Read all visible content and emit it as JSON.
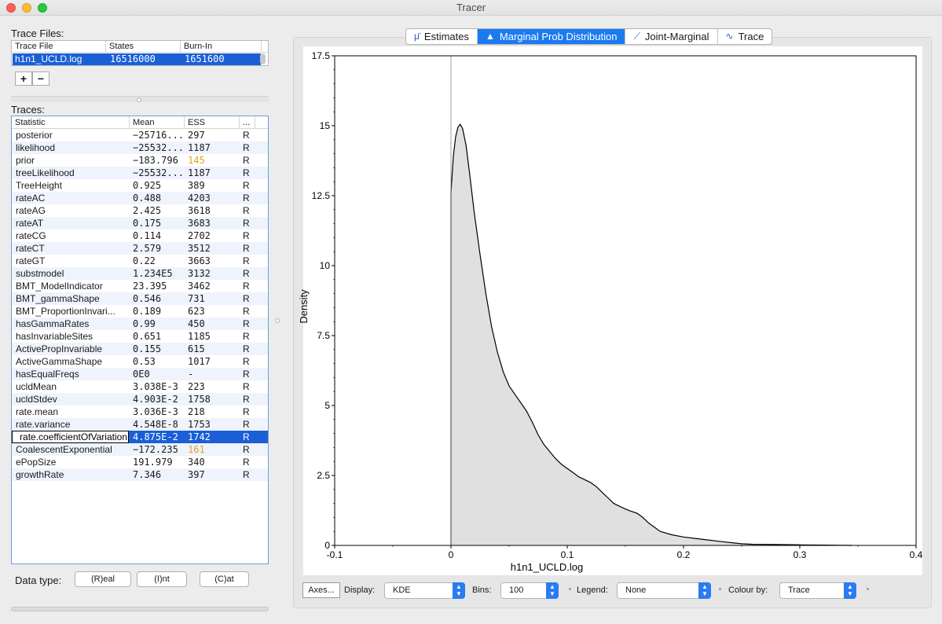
{
  "window": {
    "title": "Tracer"
  },
  "trace_files": {
    "label": "Trace Files:",
    "columns": [
      "Trace File",
      "States",
      "Burn-In"
    ],
    "row": {
      "file": "h1n1_UCLD.log",
      "states": "16516000",
      "burnin": "1651600"
    },
    "add_label": "+",
    "remove_label": "−"
  },
  "traces": {
    "label": "Traces:",
    "columns": [
      "Statistic",
      "Mean",
      "ESS",
      "..."
    ],
    "rows": [
      {
        "stat": "posterior",
        "mean": "−25716...",
        "ess": "297",
        "type": "R"
      },
      {
        "stat": "likelihood",
        "mean": "−25532...",
        "ess": "1187",
        "type": "R"
      },
      {
        "stat": "prior",
        "mean": "−183.796",
        "ess": "145",
        "type": "R"
      },
      {
        "stat": "treeLikelihood",
        "mean": "−25532...",
        "ess": "1187",
        "type": "R"
      },
      {
        "stat": "TreeHeight",
        "mean": "0.925",
        "ess": "389",
        "type": "R"
      },
      {
        "stat": "rateAC",
        "mean": "0.488",
        "ess": "4203",
        "type": "R"
      },
      {
        "stat": "rateAG",
        "mean": "2.425",
        "ess": "3618",
        "type": "R"
      },
      {
        "stat": "rateAT",
        "mean": "0.175",
        "ess": "3683",
        "type": "R"
      },
      {
        "stat": "rateCG",
        "mean": "0.114",
        "ess": "2702",
        "type": "R"
      },
      {
        "stat": "rateCT",
        "mean": "2.579",
        "ess": "3512",
        "type": "R"
      },
      {
        "stat": "rateGT",
        "mean": "0.22",
        "ess": "3663",
        "type": "R"
      },
      {
        "stat": "substmodel",
        "mean": "1.234E5",
        "ess": "3132",
        "type": "R"
      },
      {
        "stat": "BMT_ModelIndicator",
        "mean": "23.395",
        "ess": "3462",
        "type": "R"
      },
      {
        "stat": "BMT_gammaShape",
        "mean": "0.546",
        "ess": "731",
        "type": "R"
      },
      {
        "stat": "BMT_ProportionInvari...",
        "mean": "0.189",
        "ess": "623",
        "type": "R"
      },
      {
        "stat": "hasGammaRates",
        "mean": "0.99",
        "ess": "450",
        "type": "R"
      },
      {
        "stat": "hasInvariableSites",
        "mean": "0.651",
        "ess": "1185",
        "type": "R"
      },
      {
        "stat": "ActivePropInvariable",
        "mean": "0.155",
        "ess": "615",
        "type": "R"
      },
      {
        "stat": "ActiveGammaShape",
        "mean": "0.53",
        "ess": "1017",
        "type": "R"
      },
      {
        "stat": "hasEqualFreqs",
        "mean": "0E0",
        "ess": "-",
        "type": "R"
      },
      {
        "stat": "ucldMean",
        "mean": "3.038E-3",
        "ess": "223",
        "type": "R"
      },
      {
        "stat": "ucldStdev",
        "mean": "4.903E-2",
        "ess": "1758",
        "type": "R"
      },
      {
        "stat": "rate.mean",
        "mean": "3.036E-3",
        "ess": "218",
        "type": "R"
      },
      {
        "stat": "rate.variance",
        "mean": "4.548E-8",
        "ess": "1753",
        "type": "R"
      },
      {
        "stat": "rate.coefficientOfVariation",
        "mean": "4.875E-2",
        "ess": "1742",
        "type": "R"
      },
      {
        "stat": "CoalescentExponential",
        "mean": "−172.235",
        "ess": "161",
        "type": "R"
      },
      {
        "stat": "ePopSize",
        "mean": "191.979",
        "ess": "340",
        "type": "R"
      },
      {
        "stat": "growthRate",
        "mean": "7.346",
        "ess": "397",
        "type": "R"
      }
    ],
    "selected_index": 24,
    "low_ess_rows": [
      2,
      25
    ],
    "editing_text": "rate.coefficientOfVariation"
  },
  "data_type": {
    "label": "Data type:",
    "buttons": [
      "(R)eal",
      "(I)nt",
      "(C)at"
    ]
  },
  "tabs": [
    {
      "label": "Estimates",
      "icon": "mu-icon"
    },
    {
      "label": "Marginal Prob Distribution",
      "icon": "marginal-icon"
    },
    {
      "label": "Joint-Marginal",
      "icon": "joint-icon"
    },
    {
      "label": "Trace",
      "icon": "trace-icon"
    }
  ],
  "active_tab": 1,
  "controls": {
    "axes_label": "Axes...",
    "display_label": "Display:",
    "display_value": "KDE",
    "bins_label": "Bins:",
    "bins_value": "100",
    "legend_label": "Legend:",
    "legend_value": "None",
    "colour_label": "Colour by:",
    "colour_value": "Trace"
  },
  "colors": {
    "selection": "#1a5fd6",
    "tab_active": "#1a7bf0",
    "warn_ess": "#e5a01f",
    "fill": "#e0e0e0"
  },
  "chart_data": {
    "type": "area",
    "xlabel": "h1n1_UCLD.log",
    "ylabel": "Density",
    "xlim": [
      -0.1,
      0.4
    ],
    "ylim": [
      0,
      17.5
    ],
    "xticks": [
      -0.1,
      0,
      0.1,
      0.2,
      0.3,
      0.4
    ],
    "xtick_labels": [
      "-0.1",
      "0",
      "0.1",
      "0.2",
      "0.3",
      "0.4"
    ],
    "yticks": [
      0,
      2.5,
      5,
      7.5,
      10,
      12.5,
      15,
      17.5
    ],
    "ytick_labels": [
      "0",
      "2.5",
      "5",
      "7.5",
      "10",
      "12.5",
      "15",
      "17.5"
    ],
    "vertical_line_x": 0,
    "x": [
      0,
      0.002,
      0.004,
      0.006,
      0.008,
      0.01,
      0.013,
      0.016,
      0.02,
      0.025,
      0.03,
      0.035,
      0.04,
      0.045,
      0.05,
      0.055,
      0.06,
      0.065,
      0.07,
      0.075,
      0.08,
      0.085,
      0.09,
      0.095,
      0.1,
      0.105,
      0.11,
      0.115,
      0.12,
      0.125,
      0.13,
      0.135,
      0.14,
      0.145,
      0.15,
      0.155,
      0.16,
      0.165,
      0.17,
      0.175,
      0.18,
      0.19,
      0.2,
      0.21,
      0.22,
      0.23,
      0.24,
      0.25,
      0.26,
      0.28,
      0.3,
      0.32,
      0.345
    ],
    "y": [
      12.6,
      13.9,
      14.6,
      14.95,
      15.05,
      14.9,
      14.3,
      13.3,
      11.9,
      10.4,
      9.0,
      7.8,
      6.9,
      6.2,
      5.7,
      5.4,
      5.1,
      4.8,
      4.4,
      3.95,
      3.6,
      3.35,
      3.1,
      2.9,
      2.75,
      2.6,
      2.45,
      2.35,
      2.25,
      2.1,
      1.9,
      1.7,
      1.5,
      1.4,
      1.3,
      1.22,
      1.15,
      1.0,
      0.8,
      0.65,
      0.5,
      0.38,
      0.3,
      0.25,
      0.2,
      0.15,
      0.1,
      0.06,
      0.04,
      0.03,
      0.02,
      0.01,
      0.0
    ]
  }
}
